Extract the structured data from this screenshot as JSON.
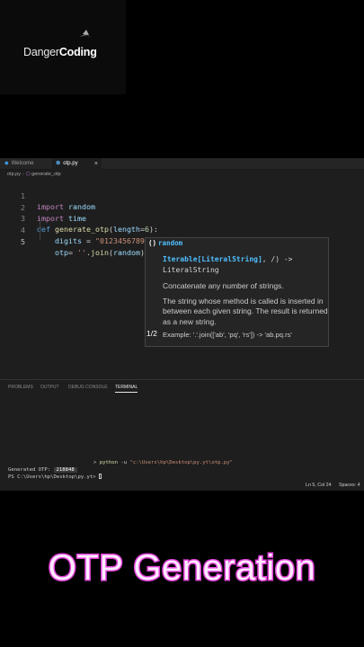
{
  "logo": {
    "part1": "Danger",
    "part2": "Coding"
  },
  "tabs": [
    {
      "label": "Welcome",
      "icon": "vscode-icon"
    },
    {
      "label": "otp.py",
      "icon": "python-icon",
      "close": "×"
    }
  ],
  "breadcrumb": {
    "file": "otp.py",
    "symbol": "generate_otp"
  },
  "code": {
    "lines": [
      {
        "num": "1",
        "kw": "import",
        "rest": " random"
      },
      {
        "num": "2",
        "kw": "import",
        "rest": " time"
      },
      {
        "num": "3"
      },
      {
        "num": "4"
      },
      {
        "num": "5"
      }
    ],
    "line3": {
      "def": "def",
      "name": "generate_otp",
      "open": "(",
      "param": "length",
      "eq": "=",
      "default": "6",
      "close": "):"
    },
    "line4": {
      "var": "digits",
      "eq": " = ",
      "str": "\"0123456789\""
    },
    "line5": {
      "var": "otp",
      "eq": "= ",
      "str": "''",
      "dot": ".",
      "fn": "join",
      "open": "(",
      "arg": "random",
      "close": ")"
    }
  },
  "popup": {
    "paren": "()",
    "title": "random",
    "sig_param": "Iterable[LiteralString]",
    "sig_rest": ", /) ->",
    "sig_ret": "LiteralString",
    "doc1": "Concatenate any number of strings.",
    "doc2": "The string whose method is called is inserted in between each given string. The result is returned as a new string.",
    "count": "1/2",
    "example": "Example: '.'.join(['ab', 'pq', 'rs']) -> 'ab.pq.rs'"
  },
  "panel": {
    "tabs": [
      "PROBLEMS",
      "OUTPUT",
      "DEBUG CONSOLE",
      "TERMINAL"
    ],
    "active_tab": "TERMINAL",
    "command_prefix": "> ",
    "command_bin": "python",
    "command_flag": " -u ",
    "command_path": "\"c:\\Users\\hp\\Desktop\\py.yt\\otp.py\"",
    "output_label": "Generated OTP: ",
    "output_value": "218848",
    "prompt": "PS C:\\Users\\hp\\Desktop\\py.yt> "
  },
  "status": {
    "position": "Ln 5, Col 24",
    "spaces": "Spaces: 4"
  },
  "caption": "OTP Generation",
  "colors": {
    "accent": "#e040d8",
    "keyword": "#c586c0",
    "function": "#dcdcaa",
    "string": "#ce9178",
    "variable": "#9cdcfe"
  }
}
